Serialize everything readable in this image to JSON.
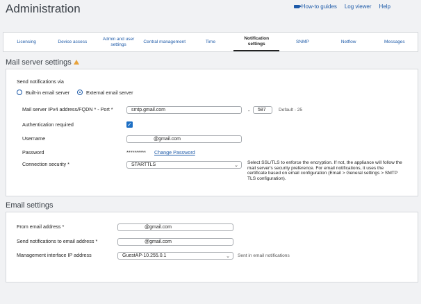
{
  "header": {
    "title": "Administration",
    "links": {
      "guides": "How-to guides",
      "logviewer": "Log viewer",
      "help": "Help"
    }
  },
  "tabs": [
    {
      "label": "Licensing"
    },
    {
      "label": "Device access"
    },
    {
      "label": "Admin and user settings"
    },
    {
      "label": "Central management"
    },
    {
      "label": "Time"
    },
    {
      "label": "Notification settings"
    },
    {
      "label": "SNMP"
    },
    {
      "label": "Netflow"
    },
    {
      "label": "Messages"
    }
  ],
  "mail_server": {
    "title": "Mail server settings",
    "send_via_label": "Send notifications via",
    "radio_builtin": "Built-in email server",
    "radio_external": "External email server",
    "server_label": "Mail server IPv4 address/FQDN * - Port *",
    "server_value": "smtp.gmail.com",
    "port_dash": "-",
    "port_value": "587",
    "port_default": "Default - 25",
    "auth_label": "Authentication required",
    "username_label": "Username",
    "username_value": "@gmail.com",
    "password_label": "Password",
    "password_value": "**********",
    "change_password": "Change Password",
    "security_label": "Connection security *",
    "security_value": "STARTTLS",
    "security_note": "Select SSL/TLS to enforce the encryption. If not, the appliance will follow the mail server's security preference. For email notifications, it uses the certificate based on email configuration (Email > General settings > SMTP TLS configuration)."
  },
  "email_settings": {
    "title": "Email settings",
    "from_label": "From email address *",
    "from_value": "@gmail.com",
    "to_label": "Send notifications to email address *",
    "to_value": "@gmail.com",
    "mgmt_label": "Management interface IP address",
    "mgmt_value": "GuestAP-10.255.0.1",
    "mgmt_hint": "Sent in email notifications"
  },
  "colors": {
    "accent": "#1d5aa8",
    "warning": "#e8a23a",
    "background": "#f1f2f4"
  }
}
